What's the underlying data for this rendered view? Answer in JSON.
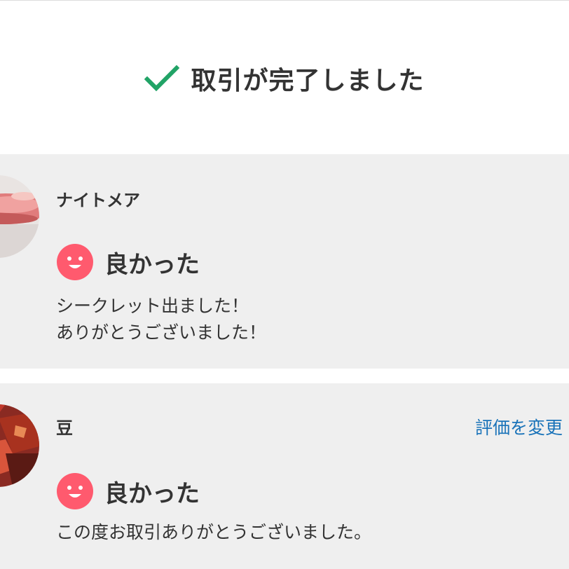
{
  "header": {
    "title": "取引が完了しました",
    "icon": "check-icon",
    "icon_color": "#21a366"
  },
  "reviews": [
    {
      "username": "ナイトメア",
      "rating_label": "良かった",
      "rating_icon": "smile-icon",
      "rating_color": "#ff5a6e",
      "comment_lines": [
        "シークレット出ました！",
        "ありがとうございました！"
      ]
    },
    {
      "username": "豆",
      "edit_link": "評価を変更",
      "rating_label": "良かった",
      "rating_icon": "smile-icon",
      "rating_color": "#ff5a6e",
      "comment_lines": [
        "この度お取引ありがとうございました。"
      ]
    }
  ],
  "colors": {
    "card_background": "#efefef",
    "link": "#1a73b9",
    "text": "#333333"
  }
}
